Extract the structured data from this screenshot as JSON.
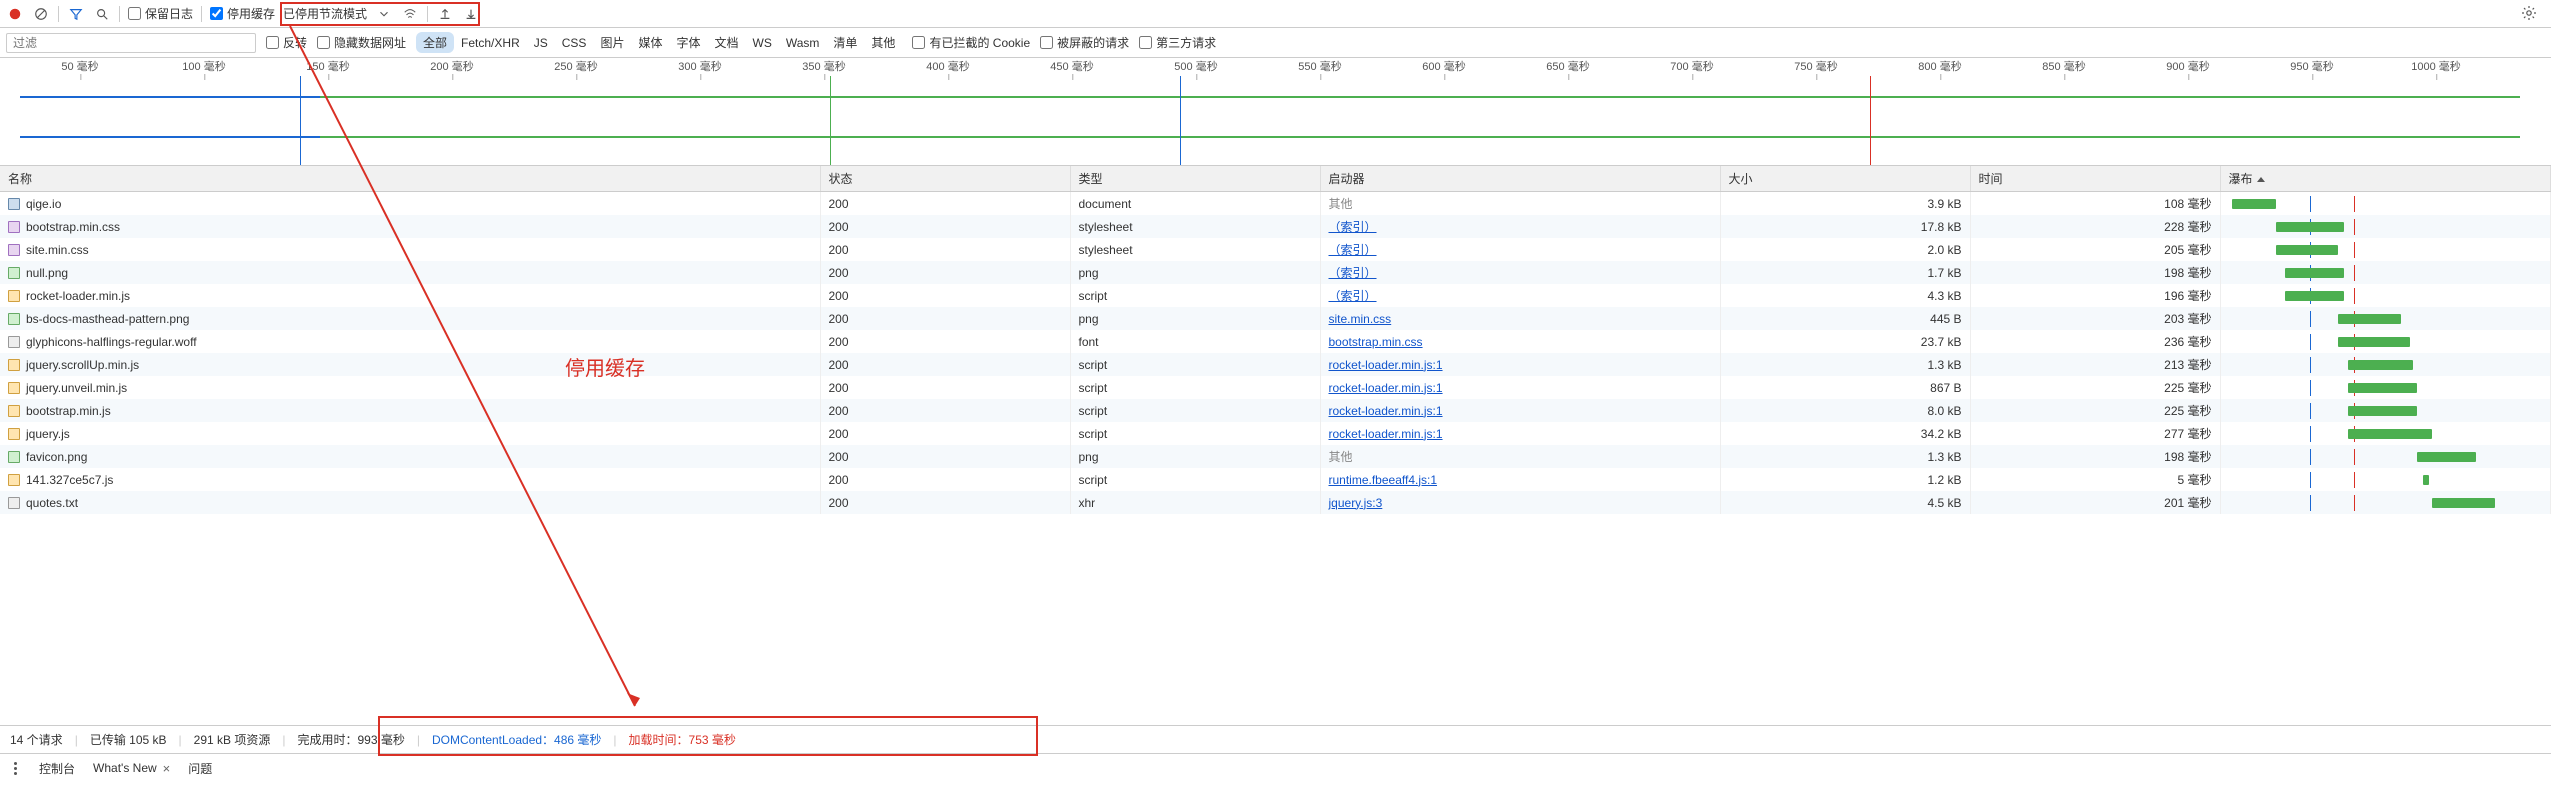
{
  "toolbar": {
    "preserve_log": "保留日志",
    "disable_cache": "停用缓存",
    "throttling": "已停用节流模式"
  },
  "filterbar": {
    "filter_placeholder": "过滤",
    "invert": "反转",
    "hide_data_urls": "隐藏数据网址",
    "types": [
      "全部",
      "Fetch/XHR",
      "JS",
      "CSS",
      "图片",
      "媒体",
      "字体",
      "文档",
      "WS",
      "Wasm",
      "清单",
      "其他"
    ],
    "blocked_cookies": "有已拦截的 Cookie",
    "blocked_requests": "被屏蔽的请求",
    "third_party": "第三方请求"
  },
  "timeline": {
    "ticks": [
      "50 毫秒",
      "100 毫秒",
      "150 毫秒",
      "200 毫秒",
      "250 毫秒",
      "300 毫秒",
      "350 毫秒",
      "400 毫秒",
      "450 毫秒",
      "500 毫秒",
      "550 毫秒",
      "600 毫秒",
      "650 毫秒",
      "700 毫秒",
      "750 毫秒",
      "800 毫秒",
      "850 毫秒",
      "900 毫秒",
      "950 毫秒",
      "1000 毫秒"
    ]
  },
  "headers": {
    "name": "名称",
    "status": "状态",
    "type": "类型",
    "initiator": "启动器",
    "size": "大小",
    "time": "时间",
    "waterfall": "瀑布"
  },
  "rows": [
    {
      "icon": "doc",
      "name": "qige.io",
      "status": "200",
      "type": "document",
      "initiator": "其他",
      "initClass": "other",
      "size": "3.9 kB",
      "time": "108 毫秒",
      "wf_start": 1,
      "wf_len": 14
    },
    {
      "icon": "css",
      "name": "bootstrap.min.css",
      "status": "200",
      "type": "stylesheet",
      "initiator": "（索引）",
      "initClass": "link",
      "size": "17.8 kB",
      "time": "228 毫秒",
      "wf_start": 15,
      "wf_len": 22
    },
    {
      "icon": "css",
      "name": "site.min.css",
      "status": "200",
      "type": "stylesheet",
      "initiator": "（索引）",
      "initClass": "link",
      "size": "2.0 kB",
      "time": "205 毫秒",
      "wf_start": 15,
      "wf_len": 20
    },
    {
      "icon": "img",
      "name": "null.png",
      "status": "200",
      "type": "png",
      "initiator": "（索引）",
      "initClass": "link",
      "size": "1.7 kB",
      "time": "198 毫秒",
      "wf_start": 18,
      "wf_len": 19
    },
    {
      "icon": "js",
      "name": "rocket-loader.min.js",
      "status": "200",
      "type": "script",
      "initiator": "（索引）",
      "initClass": "link",
      "size": "4.3 kB",
      "time": "196 毫秒",
      "wf_start": 18,
      "wf_len": 19
    },
    {
      "icon": "img",
      "name": "bs-docs-masthead-pattern.png",
      "status": "200",
      "type": "png",
      "initiator": "site.min.css",
      "initClass": "link",
      "size": "445 B",
      "time": "203 毫秒",
      "wf_start": 35,
      "wf_len": 20
    },
    {
      "icon": "txt",
      "name": "glyphicons-halflings-regular.woff",
      "status": "200",
      "type": "font",
      "initiator": "bootstrap.min.css",
      "initClass": "link",
      "size": "23.7 kB",
      "time": "236 毫秒",
      "wf_start": 35,
      "wf_len": 23
    },
    {
      "icon": "js",
      "name": "jquery.scrollUp.min.js",
      "status": "200",
      "type": "script",
      "initiator": "rocket-loader.min.js:1",
      "initClass": "link",
      "size": "1.3 kB",
      "time": "213 毫秒",
      "wf_start": 38,
      "wf_len": 21
    },
    {
      "icon": "js",
      "name": "jquery.unveil.min.js",
      "status": "200",
      "type": "script",
      "initiator": "rocket-loader.min.js:1",
      "initClass": "link",
      "size": "867 B",
      "time": "225 毫秒",
      "wf_start": 38,
      "wf_len": 22
    },
    {
      "icon": "js",
      "name": "bootstrap.min.js",
      "status": "200",
      "type": "script",
      "initiator": "rocket-loader.min.js:1",
      "initClass": "link",
      "size": "8.0 kB",
      "time": "225 毫秒",
      "wf_start": 38,
      "wf_len": 22
    },
    {
      "icon": "js",
      "name": "jquery.js",
      "status": "200",
      "type": "script",
      "initiator": "rocket-loader.min.js:1",
      "initClass": "link",
      "size": "34.2 kB",
      "time": "277 毫秒",
      "wf_start": 38,
      "wf_len": 27
    },
    {
      "icon": "img",
      "name": "favicon.png",
      "status": "200",
      "type": "png",
      "initiator": "其他",
      "initClass": "other",
      "size": "1.3 kB",
      "time": "198 毫秒",
      "wf_start": 60,
      "wf_len": 19
    },
    {
      "icon": "js",
      "name": "141.327ce5c7.js",
      "status": "200",
      "type": "script",
      "initiator": "runtime.fbeeaff4.js:1",
      "initClass": "link",
      "size": "1.2 kB",
      "time": "5 毫秒",
      "wf_start": 62,
      "wf_len": 2
    },
    {
      "icon": "txt",
      "name": "quotes.txt",
      "status": "200",
      "type": "xhr",
      "initiator": "jquery.js:3",
      "initClass": "link",
      "size": "4.5 kB",
      "time": "201 毫秒",
      "wf_start": 65,
      "wf_len": 20
    }
  ],
  "status": {
    "requests": "14 个请求",
    "transferred": "已传输 105 kB",
    "resources": "291 kB 项资源",
    "finish_label": "完成用时：",
    "finish_value": "993 毫秒",
    "dcl_label": "DOMContentLoaded：",
    "dcl_value": "486 毫秒",
    "load_label": "加载时间：",
    "load_value": "753 毫秒"
  },
  "bottom": {
    "console": "控制台",
    "whatsnew": "What's New",
    "issues": "问题"
  },
  "annotation": {
    "label": "停用缓存"
  }
}
